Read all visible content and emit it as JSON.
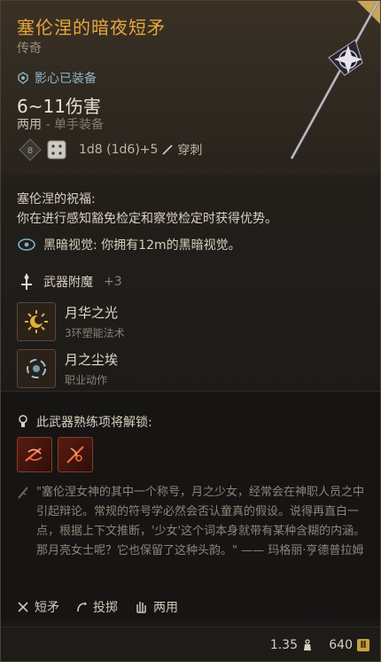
{
  "item": {
    "title": "塞伦涅的暗夜短矛",
    "rarity": "传奇",
    "attunement": "影心已装备",
    "damage": "6~11伤害",
    "hands_main": "两用",
    "hands_sub": "- 单手装备",
    "dice_formula": "1d8 (1d6)+5",
    "damage_type": "穿刺",
    "dice_icons": [
      "d8-die-icon",
      "d6-die-icon"
    ]
  },
  "blessing": {
    "title": "塞伦涅的祝福:",
    "text": "你在进行感知豁免检定和察觉检定时获得优势。"
  },
  "darkvision": {
    "label": "黑暗视觉",
    "text": ": 你拥有12m的黑暗视觉。"
  },
  "enchant": {
    "label": "武器附魔",
    "value": "+3"
  },
  "spells": [
    {
      "name": "月华之光",
      "sub": "3环塑能法术",
      "icon": "moon-sun-icon"
    },
    {
      "name": "月之尘埃",
      "sub": "职业动作",
      "icon": "moon-dust-icon"
    }
  ],
  "proficiency": {
    "label": "此武器熟练项将解锁:",
    "icons": [
      "flourish-icon",
      "lacerate-icon"
    ]
  },
  "quote": "\"塞伦涅女神的其中一个称号，月之少女，经常会在神职人员之中引起辩论。常规的符号学必然会否认童真的假设。说得再直白一点，根据上下文推断，'少女'这个词本身就带有某种含糊的内涵。那月亮女士呢？它也保留了这种头韵。\" —— 玛格丽·亨德普拉姆",
  "properties": [
    "短矛",
    "投掷",
    "两用"
  ],
  "footer": {
    "weight": "1.35",
    "value": "640"
  },
  "colors": {
    "title": "#e7a63e",
    "attune": "#8fb4c4",
    "accent": "#c9a040"
  }
}
